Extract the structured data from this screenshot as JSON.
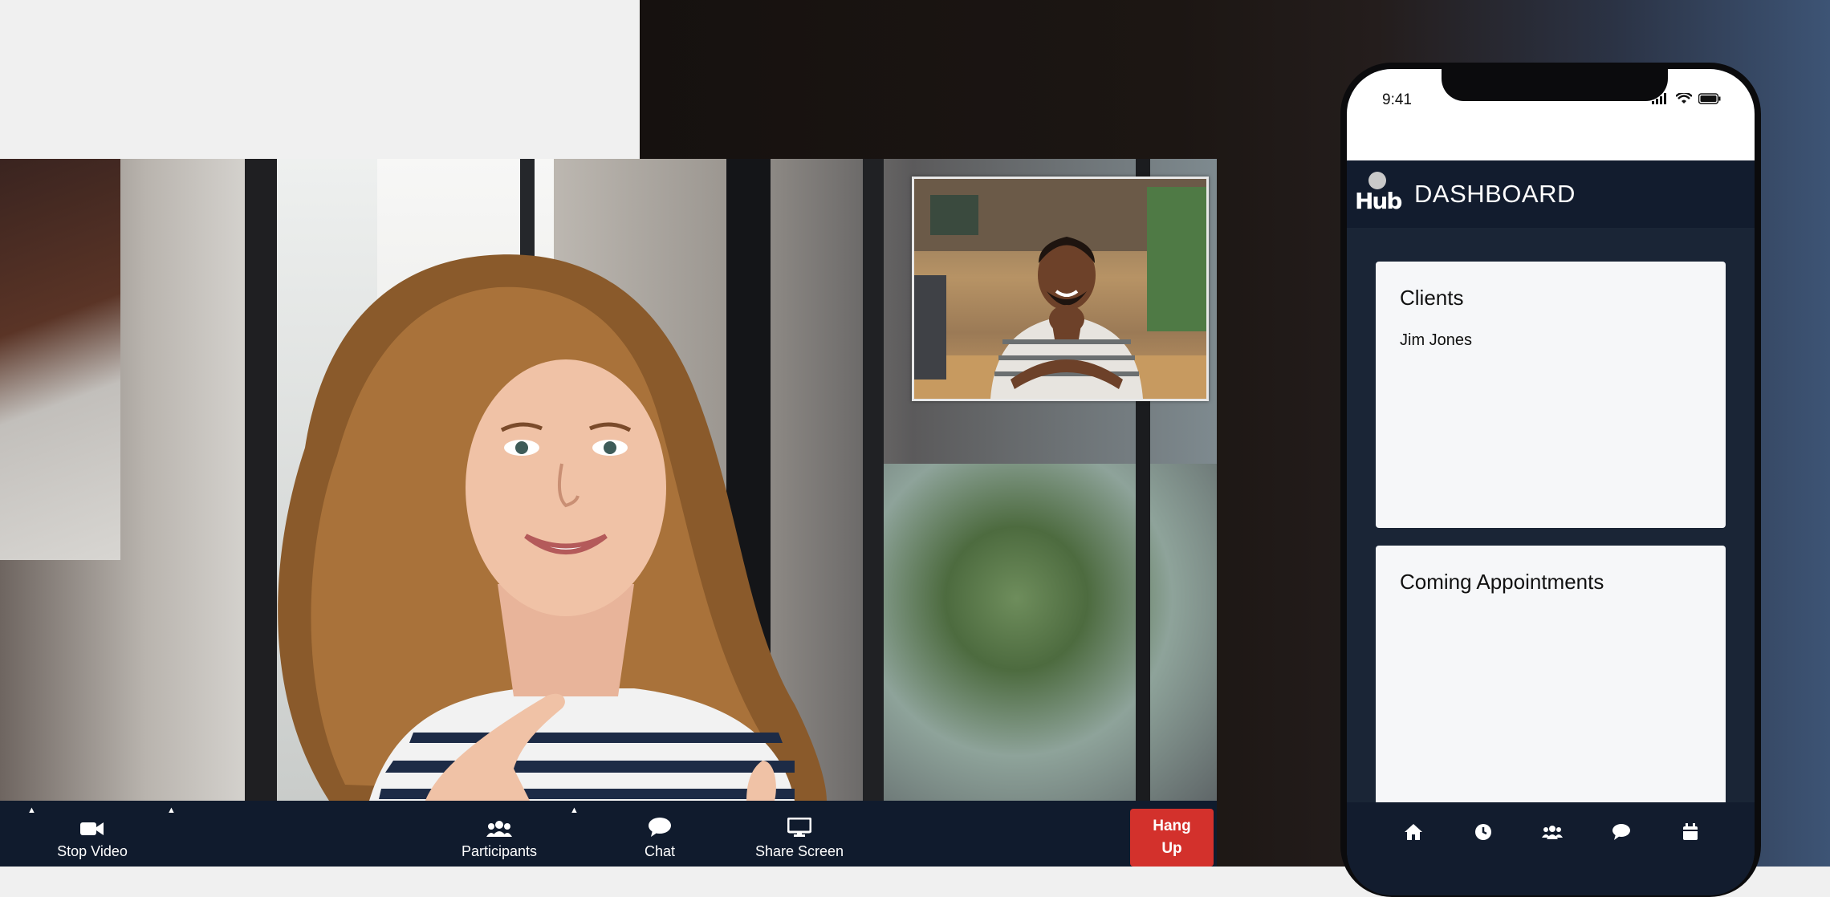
{
  "video_call": {
    "toolbar": {
      "stop_video_label": "Stop Video",
      "participants_label": "Participants",
      "chat_label": "Chat",
      "share_screen_label": "Share Screen",
      "hang_up_line1": "Hang",
      "hang_up_line2": "Up"
    }
  },
  "phone": {
    "status_time": "9:41",
    "header_title": "DASHBOARD",
    "logo_text": "Hub",
    "cards": [
      {
        "title": "Clients",
        "items": [
          "Jim Jones"
        ]
      },
      {
        "title": "Coming Appointments",
        "items": []
      }
    ],
    "bottom_nav": [
      "home-icon",
      "clock-icon",
      "people-icon",
      "chat-icon",
      "calendar-icon"
    ]
  },
  "colors": {
    "toolbar_bg": "#101b2d",
    "hang_up": "#d3312c",
    "app_header": "#121c2e",
    "card_bg": "#f6f7f9"
  }
}
